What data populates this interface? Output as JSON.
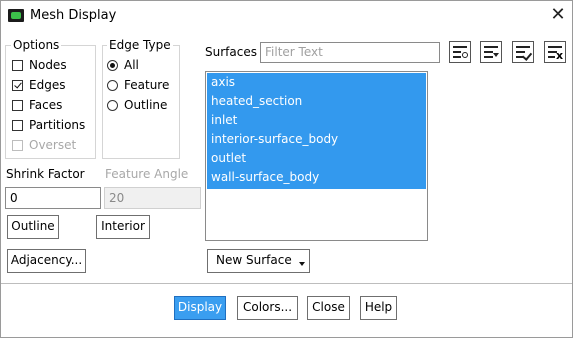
{
  "window": {
    "title": "Mesh Display"
  },
  "options": {
    "legend": "Options",
    "items": [
      {
        "label": "Nodes",
        "checked": false,
        "disabled": false
      },
      {
        "label": "Edges",
        "checked": true,
        "disabled": false
      },
      {
        "label": "Faces",
        "checked": false,
        "disabled": false
      },
      {
        "label": "Partitions",
        "checked": false,
        "disabled": false
      },
      {
        "label": "Overset",
        "checked": false,
        "disabled": true
      }
    ]
  },
  "edge_type": {
    "legend": "Edge Type",
    "items": [
      {
        "label": "All",
        "selected": true
      },
      {
        "label": "Feature",
        "selected": false
      },
      {
        "label": "Outline",
        "selected": false
      }
    ]
  },
  "shrink": {
    "label": "Shrink Factor",
    "value": "0"
  },
  "feature_angle": {
    "label": "Feature Angle",
    "value": "20"
  },
  "buttons": {
    "outline": "Outline",
    "interior": "Interior",
    "adjacency": "Adjacency...",
    "new_surface": "New Surface",
    "display": "Display",
    "colors": "Colors...",
    "close": "Close",
    "help": "Help"
  },
  "surfaces": {
    "label": "Surfaces",
    "filter_placeholder": "Filter Text",
    "items": [
      "axis",
      "heated_section",
      "inlet",
      "interior-surface_body",
      "outlet",
      "wall-surface_body"
    ],
    "selected": [
      "axis",
      "heated_section",
      "inlet",
      "interior-surface_body",
      "outlet",
      "wall-surface_body"
    ]
  },
  "toolbar_icons": [
    "new-surface-icon",
    "select-dropdown-icon",
    "select-all-icon",
    "deselect-all-icon"
  ]
}
